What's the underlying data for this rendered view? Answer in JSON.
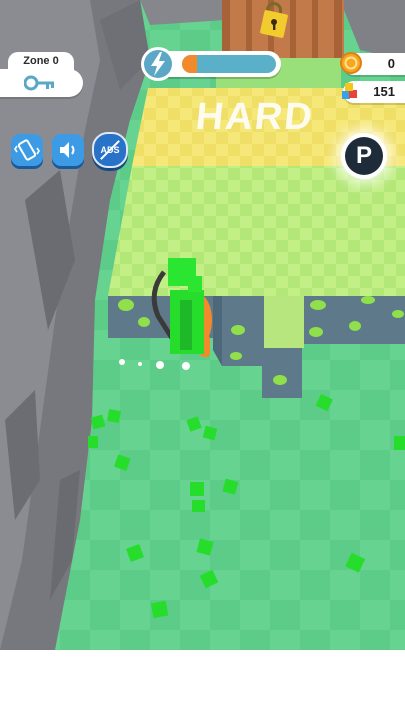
{
  "zone": {
    "label": "Zone 0",
    "icon": "key-icon"
  },
  "energy": {
    "level": 0.16,
    "icon": "lightning-icon"
  },
  "currency": {
    "coins": {
      "value": "0",
      "icon": "coin-icon"
    },
    "gems": {
      "value": "151",
      "icon": "gems-icon"
    }
  },
  "buttons": {
    "vibrate": {
      "icon": "vibrate-icon"
    },
    "sound": {
      "icon": "sound-icon"
    },
    "ads": {
      "label": "ADS",
      "icon": "no-ads-icon"
    },
    "parking": {
      "label": "P",
      "icon": "parking-icon"
    }
  },
  "world": {
    "difficulty_label": "HARD"
  },
  "colors": {
    "grass": "#5fcf8a",
    "field_light": "#b9ec7a",
    "field_yellow": "#f3e36a",
    "cube": "#26dd2b",
    "rock": "#7f8186",
    "character": "#f28a2b",
    "button_blue": "#3d9be6"
  }
}
